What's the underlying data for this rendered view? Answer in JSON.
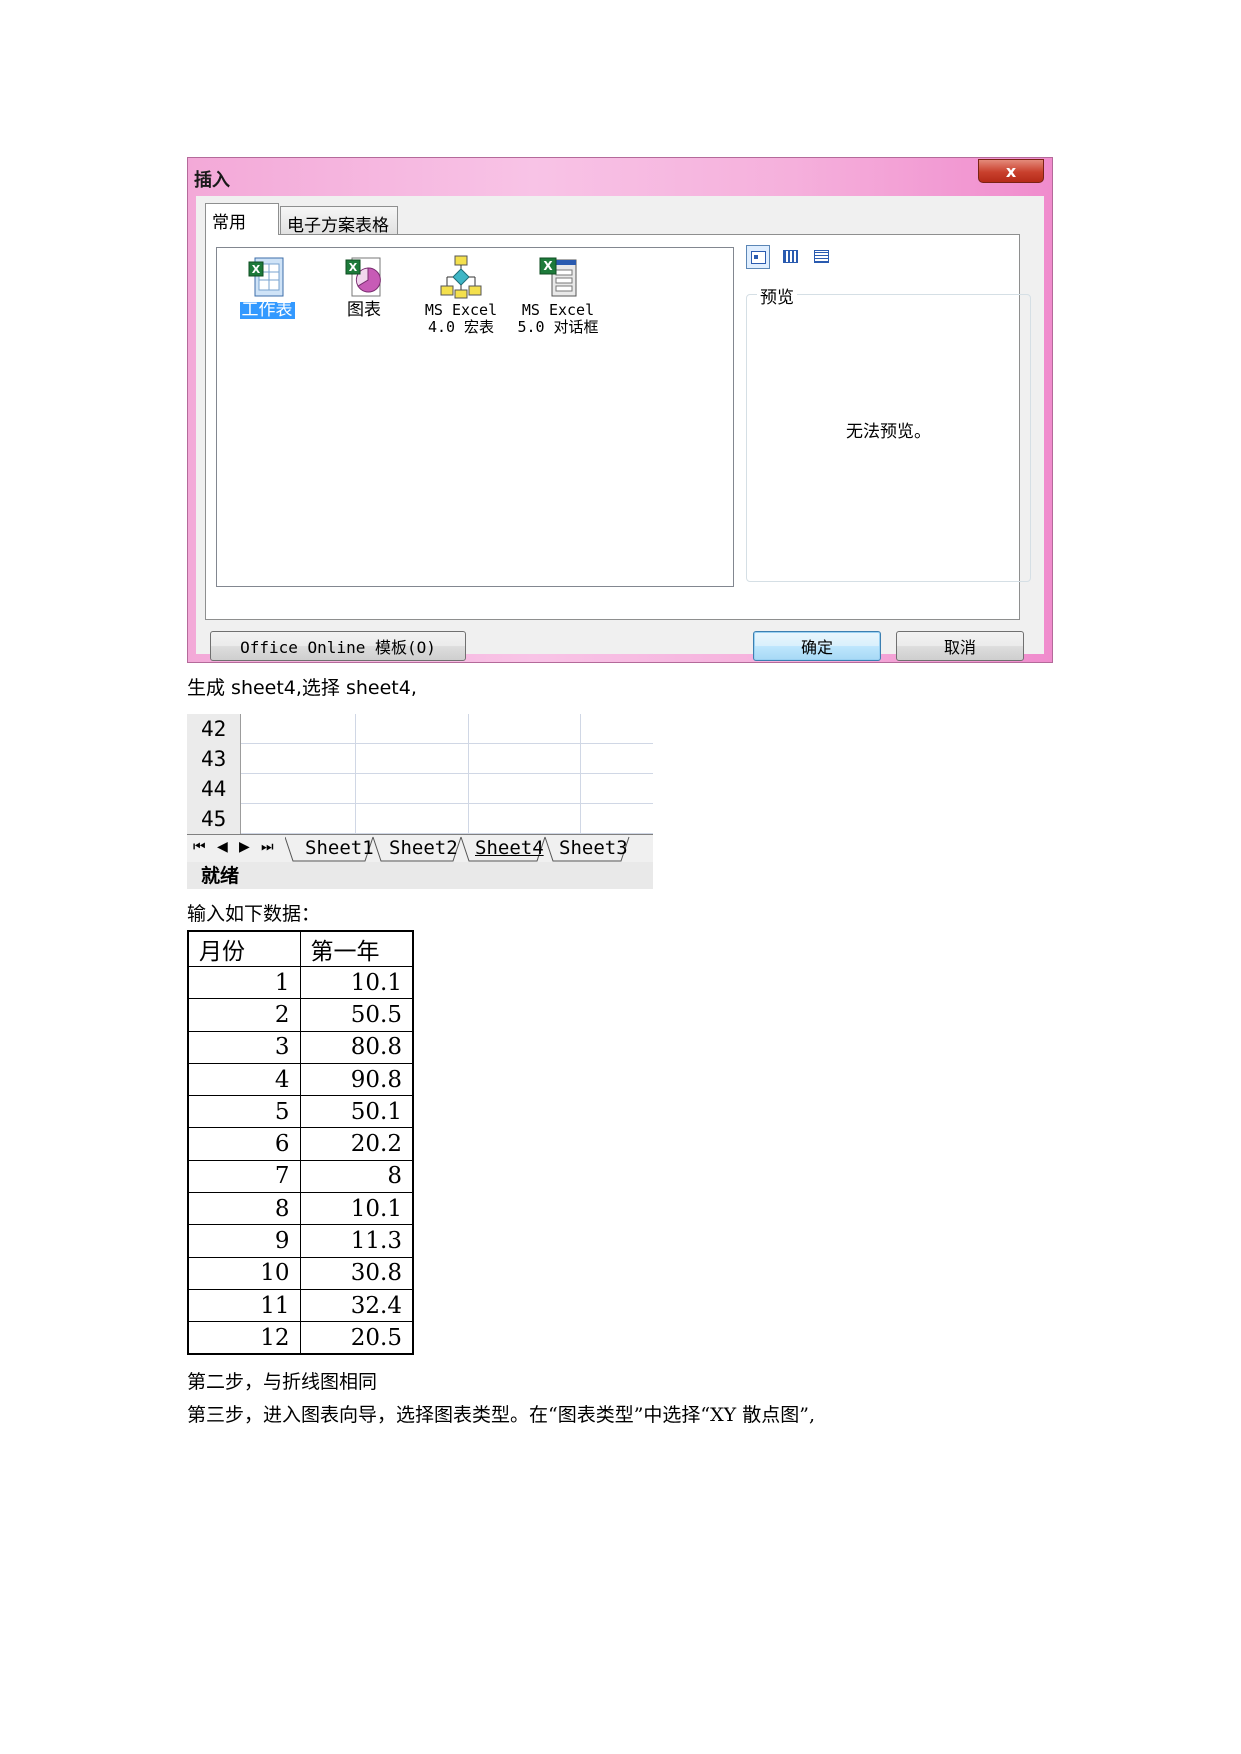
{
  "dialog": {
    "title": "插入",
    "close_label": "x",
    "tabs": [
      {
        "label": "常用",
        "active": true
      },
      {
        "label": "电子方案表格",
        "active": false
      }
    ],
    "items": [
      {
        "icon": "worksheet-icon",
        "label": "工作表",
        "selected": true
      },
      {
        "icon": "chart-icon",
        "label": "图表",
        "selected": false
      },
      {
        "icon": "macro-sheet-icon",
        "label": "MS Excel\n4.0 宏表",
        "selected": false
      },
      {
        "icon": "dialog-sheet-icon",
        "label": "MS Excel\n5.0 对话框",
        "selected": false
      }
    ],
    "view_buttons": [
      "large-icons-view-icon",
      "list-view-icon",
      "details-view-icon"
    ],
    "preview_legend": "预览",
    "preview_message": "无法预览。",
    "office_online_button": "Office Online 模板(O)",
    "ok_button": "确定",
    "cancel_button": "取消"
  },
  "text1": "生成 sheet4,选择 sheet4,",
  "sheet": {
    "rows": [
      "42",
      "43",
      "44",
      "45"
    ],
    "nav_glyphs": [
      "⏮",
      "◀",
      "▶",
      "⏭"
    ],
    "tabs": [
      "Sheet1",
      "Sheet2",
      "Sheet4",
      "Sheet3"
    ],
    "current_tab": "Sheet4",
    "status": "就绪"
  },
  "text2": "输入如下数据：",
  "table": {
    "headers": [
      "月份",
      "第一年"
    ],
    "rows": [
      [
        "1",
        "10.1"
      ],
      [
        "2",
        "50.5"
      ],
      [
        "3",
        "80.8"
      ],
      [
        "4",
        "90.8"
      ],
      [
        "5",
        "50.1"
      ],
      [
        "6",
        "20.2"
      ],
      [
        "7",
        "8"
      ],
      [
        "8",
        "10.1"
      ],
      [
        "9",
        "11.3"
      ],
      [
        "10",
        "30.8"
      ],
      [
        "11",
        "32.4"
      ],
      [
        "12",
        "20.5"
      ]
    ]
  },
  "text3": "第二步，与折线图相同",
  "text4": "第三步，进入图表向导，选择图表类型。在“图表类型”中选择“XY 散点图”,"
}
